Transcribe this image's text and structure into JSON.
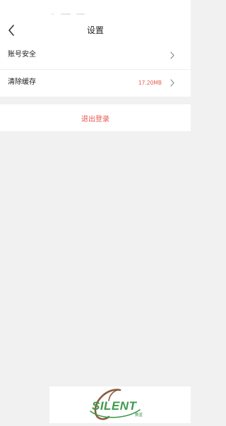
{
  "header": {
    "title": "设置",
    "back_icon": "chevron-left-icon"
  },
  "menu": {
    "items": [
      {
        "label": "账号安全",
        "value": "",
        "icon": "chevron-right-icon"
      },
      {
        "label": "清除缓存",
        "value": "17.20MB",
        "icon": "chevron-right-icon"
      }
    ]
  },
  "logout": {
    "label": "退出登录"
  },
  "watermark": {
    "logo_text": "SILENT",
    "logo_subtext": "赛蓝"
  },
  "colors": {
    "accent_red": "#e55a52",
    "background": "#f1f1f1",
    "surface": "#ffffff",
    "logo_green": "#3f9a4e",
    "logo_brown": "#8b5a3c"
  }
}
